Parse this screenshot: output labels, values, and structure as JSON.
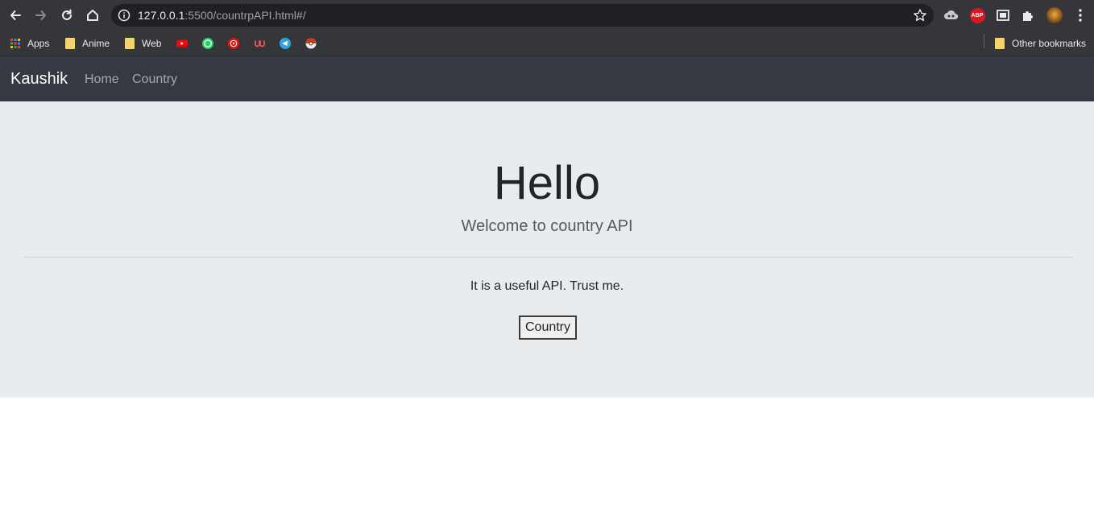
{
  "browser": {
    "url_host": "127.0.0.1",
    "url_path": ":5500/countrpAPI.html#/",
    "bookmarks": {
      "apps": "Apps",
      "anime": "Anime",
      "web": "Web",
      "other": "Other bookmarks"
    },
    "extension_badge": "ABP"
  },
  "navbar": {
    "brand": "Kaushik",
    "links": [
      "Home",
      "Country"
    ]
  },
  "jumbotron": {
    "title": "Hello",
    "lead": "Welcome to country API",
    "text": "It is a useful API. Trust me.",
    "button_label": "Country"
  },
  "colors": {
    "navbar_bg": "#343a40",
    "jumbotron_bg": "#e9ecef",
    "browser_chrome": "#35363a"
  }
}
